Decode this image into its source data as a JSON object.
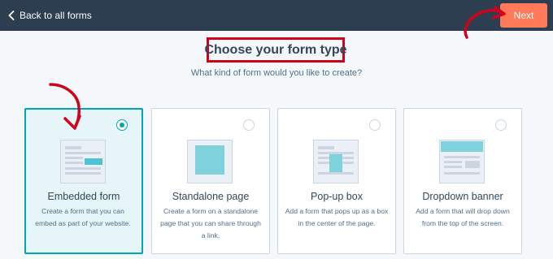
{
  "header": {
    "back_label": "Back to all forms",
    "next_label": "Next"
  },
  "page": {
    "title": "Choose your form type",
    "subtitle": "What kind of form would you like to create?"
  },
  "cards": [
    {
      "title": "Embedded form",
      "desc": "Create a form that you can embed as part of your website.",
      "selected": true
    },
    {
      "title": "Standalone page",
      "desc": "Create a form on a standalone page that you can share through a link.",
      "selected": false
    },
    {
      "title": "Pop-up box",
      "desc": "Add a form that pops up as a box in the center of the page.",
      "selected": false
    },
    {
      "title": "Dropdown banner",
      "desc": "Add a form that will drop down from the top of the screen.",
      "selected": false
    }
  ],
  "colors": {
    "header_bg": "#2d3e50",
    "accent": "#ff7a59",
    "teal": "#00a4bd",
    "highlight_red": "#d0021b"
  }
}
